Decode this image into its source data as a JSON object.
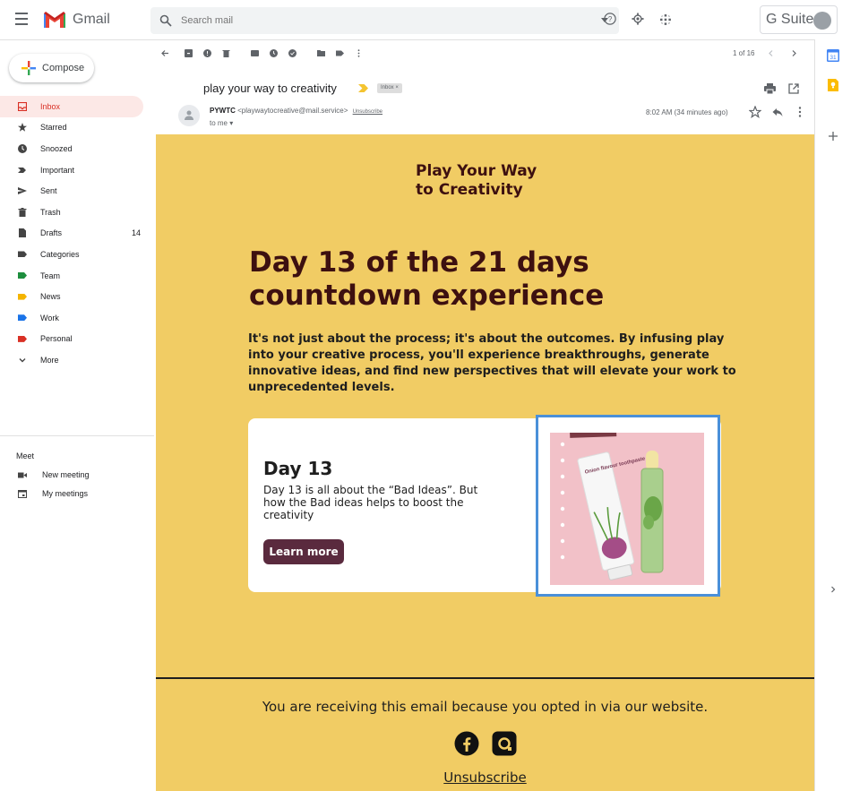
{
  "app": {
    "name": "Gmail",
    "search_placeholder": "Search mail",
    "gsuite_label": "G Suite"
  },
  "compose": {
    "label": "Compose"
  },
  "nav": {
    "items": [
      {
        "label": "Inbox",
        "count": "",
        "icon": "inbox-icon"
      },
      {
        "label": "Starred",
        "count": "",
        "icon": "star-icon"
      },
      {
        "label": "Snoozed",
        "count": "",
        "icon": "clock-icon"
      },
      {
        "label": "Important",
        "count": "",
        "icon": "important-icon"
      },
      {
        "label": "Sent",
        "count": "",
        "icon": "send-icon"
      },
      {
        "label": "Trash",
        "count": "",
        "icon": "trash-icon"
      },
      {
        "label": "Drafts",
        "count": "14",
        "icon": "draft-icon"
      },
      {
        "label": "Categories",
        "count": "",
        "icon": "label-icon"
      },
      {
        "label": "Team",
        "count": "",
        "icon": "label-icon"
      },
      {
        "label": "News",
        "count": "",
        "icon": "label-icon"
      },
      {
        "label": "Work",
        "count": "",
        "icon": "label-icon"
      },
      {
        "label": "Personal",
        "count": "",
        "icon": "label-icon"
      },
      {
        "label": "More",
        "count": "",
        "icon": "chevron-down-icon"
      }
    ]
  },
  "meet": {
    "title": "Meet",
    "new_meeting": "New meeting",
    "my_meetings": "My meetings"
  },
  "toolbar": {
    "page_count": "1 of 16"
  },
  "message": {
    "subject": "play your way to creativity",
    "label_chip": "Inbox ×",
    "sender_name": "PYWTC",
    "sender_email": "<playwaytocreative@mail.service>",
    "unsubscribe_link": "Unsubscribe",
    "to": "to me ▾",
    "time": "8:02 AM (34 minutes ago)"
  },
  "email": {
    "brand_line1": "Play Your Way",
    "brand_line2": "to Creativity",
    "headline": "Day 13 of the 21 days countdown experience",
    "intro": "It's not just about the process; it's about the outcomes. By infusing play into your creative process, you'll experience breakthroughs, generate innovative ideas, and find new perspectives that will elevate your work to unprecedented levels.",
    "card_title": "Day 13",
    "card_text": "Day 13 is all about the “Bad Ideas”. But how the Bad ideas helps to boost the creativity",
    "card_button": "Learn more",
    "product_label": "Onion flavour toothpaste",
    "footer_text": "You are receiving this email because you opted in via our website.",
    "unsubscribe": "Unsubscribe"
  },
  "colors": {
    "email_bg": "#f1cc64",
    "headline": "#3d1010",
    "button": "#5a2a3e",
    "inbox_active": "#fce8e6",
    "inbox_text": "#d93025",
    "team_label": "#1e8e3e",
    "news_label": "#f4b400",
    "work_label": "#1a73e8",
    "personal_label": "#d93025"
  }
}
